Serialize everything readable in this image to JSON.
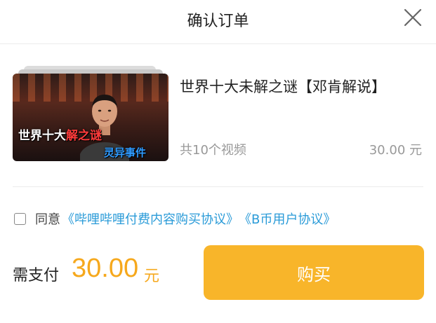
{
  "header": {
    "title": "确认订单",
    "close_icon": "close-icon"
  },
  "course": {
    "thumbnail": {
      "caption_line1_white": "世界十大",
      "caption_line1_red": "解之谜",
      "caption_line2": "灵异事件"
    },
    "title": "世界十大未解之谜【邓肯解说】",
    "count": "共10个视频",
    "price": "30.00 元"
  },
  "agreement": {
    "checked": false,
    "prefix": "同意",
    "link1": "《哔哩哔哩付费内容购买协议》",
    "link2": "《B币用户协议》"
  },
  "payment": {
    "label": "需支付",
    "amount": "30.00",
    "unit": "元",
    "buy_label": "购买"
  },
  "colors": {
    "accent": "#f8b52a",
    "price": "#f6a81c",
    "link": "#2a9bd8"
  }
}
